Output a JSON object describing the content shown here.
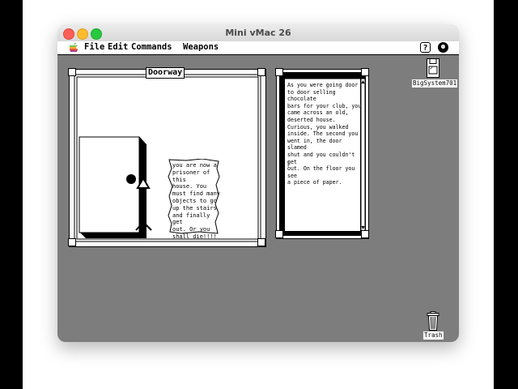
{
  "window": {
    "title": "Mini vMac 26"
  },
  "menubar": {
    "items": [
      "File",
      "Edit",
      "Commands",
      "Weapons"
    ],
    "help_glyph": "?",
    "app_glyph": "⚉"
  },
  "scene_window": {
    "title": "Doorway",
    "note": "you are now a\nprisoner of this\nhouse.  You\nmust find many\nobjects to go\nup the stairs\nand finally get\nout.  Or you\nshall die!!!!"
  },
  "text_window": {
    "text": "As you were going door\nto door selling chocolate\nbars for your club, you\ncame across an old,\ndeserted house.\nCurious, you walked\ninside.  The second you\nwent in, the door slamed\nshut and you couldn't get\nout.  On the floor you see\na piece of paper.",
    "cursor": "|"
  },
  "desktop_icons": {
    "disk_label": "BigSystem701",
    "disk_glyph": "✓",
    "trash_label": "Trash"
  }
}
